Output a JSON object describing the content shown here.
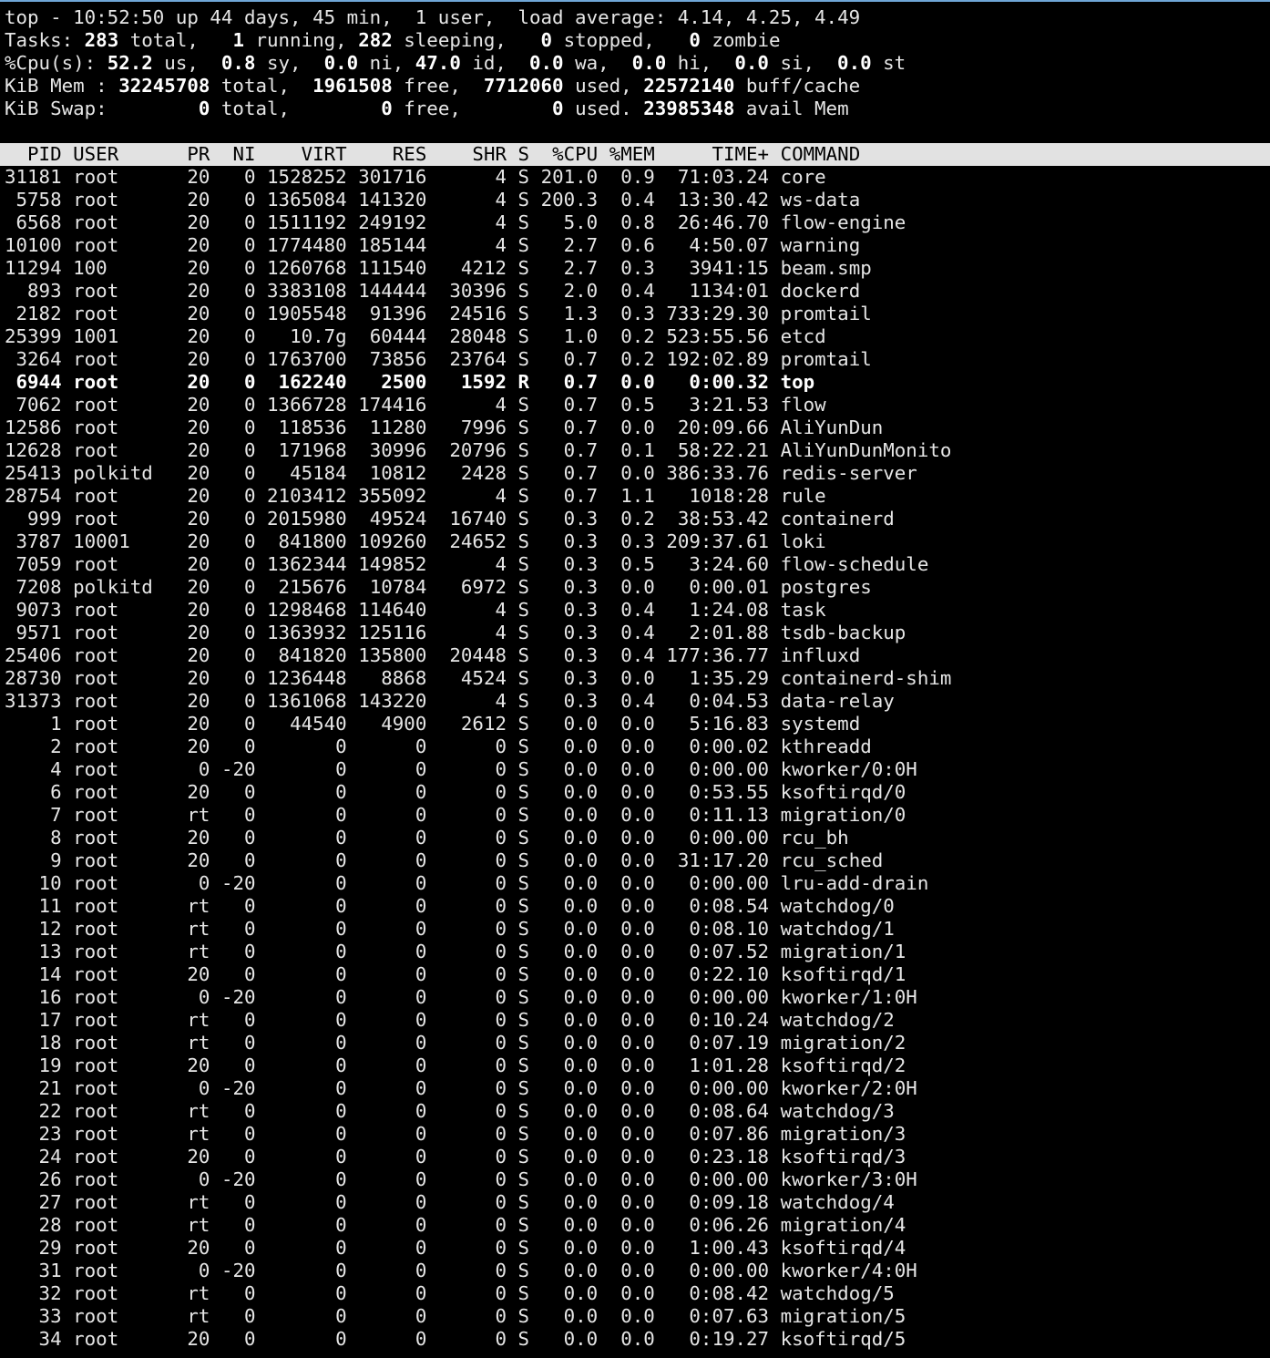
{
  "summary": {
    "line1": {
      "time": "10:52:50",
      "uptime": "44 days, 45 min",
      "users": "1 user",
      "load_1": "4.14",
      "load_5": "4.25",
      "load_15": "4.49"
    },
    "tasks": {
      "total": "283",
      "running": "1",
      "sleeping": "282",
      "stopped": "0",
      "zombie": "0"
    },
    "cpu": {
      "us": "52.2",
      "sy": "0.8",
      "ni": "0.0",
      "id": "47.0",
      "wa": "0.0",
      "hi": "0.0",
      "si": "0.0",
      "st": "0.0"
    },
    "mem": {
      "total": "32245708",
      "free": "1961508",
      "used": "7712060",
      "buff_cache": "22572140"
    },
    "swap": {
      "total": "0",
      "free": "0",
      "used": "0",
      "avail_mem": "23985348"
    }
  },
  "columns": [
    "PID",
    "USER",
    "PR",
    "NI",
    "VIRT",
    "RES",
    "SHR",
    "S",
    "%CPU",
    "%MEM",
    "TIME+",
    "COMMAND"
  ],
  "processes": [
    [
      "31181",
      "root",
      "20",
      "0",
      "1528252",
      "301716",
      "4",
      "S",
      "201.0",
      "0.9",
      "71:03.24",
      "core"
    ],
    [
      "5758",
      "root",
      "20",
      "0",
      "1365084",
      "141320",
      "4",
      "S",
      "200.3",
      "0.4",
      "13:30.42",
      "ws-data"
    ],
    [
      "6568",
      "root",
      "20",
      "0",
      "1511192",
      "249192",
      "4",
      "S",
      "5.0",
      "0.8",
      "26:46.70",
      "flow-engine"
    ],
    [
      "10100",
      "root",
      "20",
      "0",
      "1774480",
      "185144",
      "4",
      "S",
      "2.7",
      "0.6",
      "4:50.07",
      "warning"
    ],
    [
      "11294",
      "100",
      "20",
      "0",
      "1260768",
      "111540",
      "4212",
      "S",
      "2.7",
      "0.3",
      "3941:15",
      "beam.smp"
    ],
    [
      "893",
      "root",
      "20",
      "0",
      "3383108",
      "144444",
      "30396",
      "S",
      "2.0",
      "0.4",
      "1134:01",
      "dockerd"
    ],
    [
      "2182",
      "root",
      "20",
      "0",
      "1905548",
      "91396",
      "24516",
      "S",
      "1.3",
      "0.3",
      "733:29.30",
      "promtail"
    ],
    [
      "25399",
      "1001",
      "20",
      "0",
      "10.7g",
      "60444",
      "28048",
      "S",
      "1.0",
      "0.2",
      "523:55.56",
      "etcd"
    ],
    [
      "3264",
      "root",
      "20",
      "0",
      "1763700",
      "73856",
      "23764",
      "S",
      "0.7",
      "0.2",
      "192:02.89",
      "promtail"
    ],
    [
      "6944",
      "root",
      "20",
      "0",
      "162240",
      "2500",
      "1592",
      "R",
      "0.7",
      "0.0",
      "0:00.32",
      "top"
    ],
    [
      "7062",
      "root",
      "20",
      "0",
      "1366728",
      "174416",
      "4",
      "S",
      "0.7",
      "0.5",
      "3:21.53",
      "flow"
    ],
    [
      "12586",
      "root",
      "20",
      "0",
      "118536",
      "11280",
      "7996",
      "S",
      "0.7",
      "0.0",
      "20:09.66",
      "AliYunDun"
    ],
    [
      "12628",
      "root",
      "20",
      "0",
      "171968",
      "30996",
      "20796",
      "S",
      "0.7",
      "0.1",
      "58:22.21",
      "AliYunDunMonito"
    ],
    [
      "25413",
      "polkitd",
      "20",
      "0",
      "45184",
      "10812",
      "2428",
      "S",
      "0.7",
      "0.0",
      "386:33.76",
      "redis-server"
    ],
    [
      "28754",
      "root",
      "20",
      "0",
      "2103412",
      "355092",
      "4",
      "S",
      "0.7",
      "1.1",
      "1018:28",
      "rule"
    ],
    [
      "999",
      "root",
      "20",
      "0",
      "2015980",
      "49524",
      "16740",
      "S",
      "0.3",
      "0.2",
      "38:53.42",
      "containerd"
    ],
    [
      "3787",
      "10001",
      "20",
      "0",
      "841800",
      "109260",
      "24652",
      "S",
      "0.3",
      "0.3",
      "209:37.61",
      "loki"
    ],
    [
      "7059",
      "root",
      "20",
      "0",
      "1362344",
      "149852",
      "4",
      "S",
      "0.3",
      "0.5",
      "3:24.60",
      "flow-schedule"
    ],
    [
      "7208",
      "polkitd",
      "20",
      "0",
      "215676",
      "10784",
      "6972",
      "S",
      "0.3",
      "0.0",
      "0:00.01",
      "postgres"
    ],
    [
      "9073",
      "root",
      "20",
      "0",
      "1298468",
      "114640",
      "4",
      "S",
      "0.3",
      "0.4",
      "1:24.08",
      "task"
    ],
    [
      "9571",
      "root",
      "20",
      "0",
      "1363932",
      "125116",
      "4",
      "S",
      "0.3",
      "0.4",
      "2:01.88",
      "tsdb-backup"
    ],
    [
      "25406",
      "root",
      "20",
      "0",
      "841820",
      "135800",
      "20448",
      "S",
      "0.3",
      "0.4",
      "177:36.77",
      "influxd"
    ],
    [
      "28730",
      "root",
      "20",
      "0",
      "1236448",
      "8868",
      "4524",
      "S",
      "0.3",
      "0.0",
      "1:35.29",
      "containerd-shim"
    ],
    [
      "31373",
      "root",
      "20",
      "0",
      "1361068",
      "143220",
      "4",
      "S",
      "0.3",
      "0.4",
      "0:04.53",
      "data-relay"
    ],
    [
      "1",
      "root",
      "20",
      "0",
      "44540",
      "4900",
      "2612",
      "S",
      "0.0",
      "0.0",
      "5:16.83",
      "systemd"
    ],
    [
      "2",
      "root",
      "20",
      "0",
      "0",
      "0",
      "0",
      "S",
      "0.0",
      "0.0",
      "0:00.02",
      "kthreadd"
    ],
    [
      "4",
      "root",
      "0",
      "-20",
      "0",
      "0",
      "0",
      "S",
      "0.0",
      "0.0",
      "0:00.00",
      "kworker/0:0H"
    ],
    [
      "6",
      "root",
      "20",
      "0",
      "0",
      "0",
      "0",
      "S",
      "0.0",
      "0.0",
      "0:53.55",
      "ksoftirqd/0"
    ],
    [
      "7",
      "root",
      "rt",
      "0",
      "0",
      "0",
      "0",
      "S",
      "0.0",
      "0.0",
      "0:11.13",
      "migration/0"
    ],
    [
      "8",
      "root",
      "20",
      "0",
      "0",
      "0",
      "0",
      "S",
      "0.0",
      "0.0",
      "0:00.00",
      "rcu_bh"
    ],
    [
      "9",
      "root",
      "20",
      "0",
      "0",
      "0",
      "0",
      "S",
      "0.0",
      "0.0",
      "31:17.20",
      "rcu_sched"
    ],
    [
      "10",
      "root",
      "0",
      "-20",
      "0",
      "0",
      "0",
      "S",
      "0.0",
      "0.0",
      "0:00.00",
      "lru-add-drain"
    ],
    [
      "11",
      "root",
      "rt",
      "0",
      "0",
      "0",
      "0",
      "S",
      "0.0",
      "0.0",
      "0:08.54",
      "watchdog/0"
    ],
    [
      "12",
      "root",
      "rt",
      "0",
      "0",
      "0",
      "0",
      "S",
      "0.0",
      "0.0",
      "0:08.10",
      "watchdog/1"
    ],
    [
      "13",
      "root",
      "rt",
      "0",
      "0",
      "0",
      "0",
      "S",
      "0.0",
      "0.0",
      "0:07.52",
      "migration/1"
    ],
    [
      "14",
      "root",
      "20",
      "0",
      "0",
      "0",
      "0",
      "S",
      "0.0",
      "0.0",
      "0:22.10",
      "ksoftirqd/1"
    ],
    [
      "16",
      "root",
      "0",
      "-20",
      "0",
      "0",
      "0",
      "S",
      "0.0",
      "0.0",
      "0:00.00",
      "kworker/1:0H"
    ],
    [
      "17",
      "root",
      "rt",
      "0",
      "0",
      "0",
      "0",
      "S",
      "0.0",
      "0.0",
      "0:10.24",
      "watchdog/2"
    ],
    [
      "18",
      "root",
      "rt",
      "0",
      "0",
      "0",
      "0",
      "S",
      "0.0",
      "0.0",
      "0:07.19",
      "migration/2"
    ],
    [
      "19",
      "root",
      "20",
      "0",
      "0",
      "0",
      "0",
      "S",
      "0.0",
      "0.0",
      "1:01.28",
      "ksoftirqd/2"
    ],
    [
      "21",
      "root",
      "0",
      "-20",
      "0",
      "0",
      "0",
      "S",
      "0.0",
      "0.0",
      "0:00.00",
      "kworker/2:0H"
    ],
    [
      "22",
      "root",
      "rt",
      "0",
      "0",
      "0",
      "0",
      "S",
      "0.0",
      "0.0",
      "0:08.64",
      "watchdog/3"
    ],
    [
      "23",
      "root",
      "rt",
      "0",
      "0",
      "0",
      "0",
      "S",
      "0.0",
      "0.0",
      "0:07.86",
      "migration/3"
    ],
    [
      "24",
      "root",
      "20",
      "0",
      "0",
      "0",
      "0",
      "S",
      "0.0",
      "0.0",
      "0:23.18",
      "ksoftirqd/3"
    ],
    [
      "26",
      "root",
      "0",
      "-20",
      "0",
      "0",
      "0",
      "S",
      "0.0",
      "0.0",
      "0:00.00",
      "kworker/3:0H"
    ],
    [
      "27",
      "root",
      "rt",
      "0",
      "0",
      "0",
      "0",
      "S",
      "0.0",
      "0.0",
      "0:09.18",
      "watchdog/4"
    ],
    [
      "28",
      "root",
      "rt",
      "0",
      "0",
      "0",
      "0",
      "S",
      "0.0",
      "0.0",
      "0:06.26",
      "migration/4"
    ],
    [
      "29",
      "root",
      "20",
      "0",
      "0",
      "0",
      "0",
      "S",
      "0.0",
      "0.0",
      "1:00.43",
      "ksoftirqd/4"
    ],
    [
      "31",
      "root",
      "0",
      "-20",
      "0",
      "0",
      "0",
      "S",
      "0.0",
      "0.0",
      "0:00.00",
      "kworker/4:0H"
    ],
    [
      "32",
      "root",
      "rt",
      "0",
      "0",
      "0",
      "0",
      "S",
      "0.0",
      "0.0",
      "0:08.42",
      "watchdog/5"
    ],
    [
      "33",
      "root",
      "rt",
      "0",
      "0",
      "0",
      "0",
      "S",
      "0.0",
      "0.0",
      "0:07.63",
      "migration/5"
    ],
    [
      "34",
      "root",
      "20",
      "0",
      "0",
      "0",
      "0",
      "S",
      "0.0",
      "0.0",
      "0:19.27",
      "ksoftirqd/5"
    ]
  ],
  "colors": {
    "background": "#000000",
    "foreground": "#e6e6e6",
    "bold": "#ffffff",
    "header_bar": "#e2e2e2",
    "header_text": "#000000",
    "window_accent": "#6fa6d6"
  }
}
